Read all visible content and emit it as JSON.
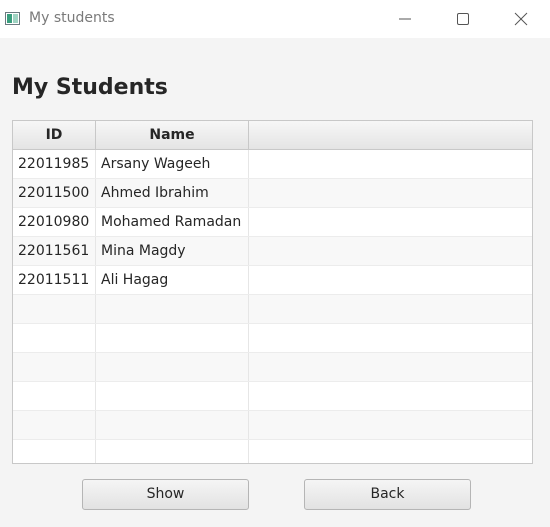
{
  "window": {
    "title": "My students",
    "icon": "app-table-icon",
    "controls": [
      "minimize-icon",
      "maximize-icon",
      "close-icon"
    ]
  },
  "page": {
    "title": "My Students"
  },
  "table": {
    "columns": [
      "ID",
      "Name",
      ""
    ],
    "rows": [
      {
        "id": "22011985",
        "name": "Arsany Wageeh"
      },
      {
        "id": "22011500",
        "name": "Ahmed Ibrahim"
      },
      {
        "id": "22010980",
        "name": "Mohamed Ramadan"
      },
      {
        "id": "22011561",
        "name": "Mina Magdy"
      },
      {
        "id": "22011511",
        "name": "Ali Hagag"
      }
    ],
    "empty_row_count": 6
  },
  "buttons": {
    "show": "Show",
    "back": "Back"
  },
  "colors": {
    "background": "#f4f4f4",
    "titlebar": "#ffffff",
    "header_gradient_top": "#f7f7f7",
    "header_gradient_bottom": "#e4e4e4",
    "row_alt": "#f8f8f8",
    "text": "#262626"
  }
}
